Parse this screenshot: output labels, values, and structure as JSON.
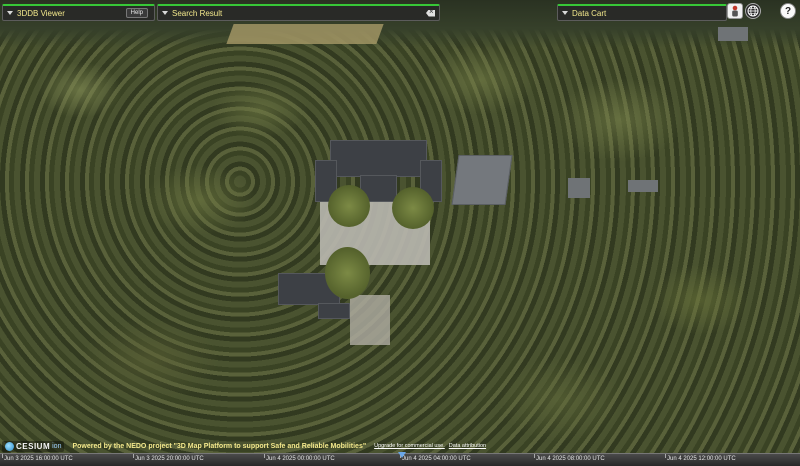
{
  "app": {
    "viewer_panel": {
      "title": "3DDB Viewer",
      "help_label": "Help"
    },
    "search_panel": {
      "title": "Search Result"
    },
    "cart_panel": {
      "title": "Data Cart",
      "dim_text": ""
    }
  },
  "tools": [
    {
      "name": "person-icon"
    },
    {
      "name": "globe-icon"
    },
    {
      "name": "help-icon",
      "label": "?"
    }
  ],
  "credits": {
    "logo_text": "CESIUM",
    "logo_sub": "ion",
    "main": "Powered by the NEDO project \"3D Map Platform to support Safe and Reliable Mobilities\"",
    "links": [
      "Upgrade for commercial use.",
      "Data attribution"
    ]
  },
  "timeline": {
    "labels": [
      "Jun 3 2025 16:00:00 UTC",
      "Jun 3 2025 20:00:00 UTC",
      "Jun 4 2025 00:00:00 UTC",
      "Jun 4 2025 04:00:00 UTC",
      "Jun 4 2025 08:00:00 UTC",
      "Jun 4 2025 12:00:00 UTC"
    ]
  },
  "colors": {
    "accent": "#37c837",
    "panel_text": "#f3e88c"
  }
}
